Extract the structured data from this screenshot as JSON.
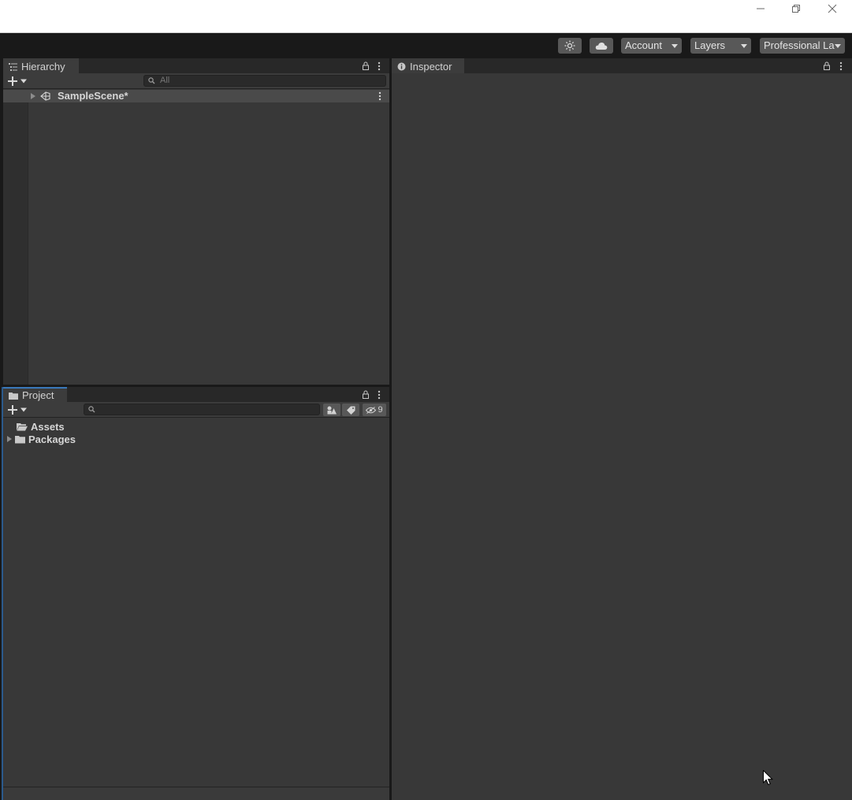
{
  "toolbar": {
    "account_label": "Account",
    "layers_label": "Layers",
    "layout_label": "Professional La",
    "icons": [
      "lighting-icon",
      "cloud-icon"
    ]
  },
  "window_controls": [
    "minimize-icon",
    "restore-icon",
    "close-icon"
  ],
  "hierarchy": {
    "tab_label": "Hierarchy",
    "search_placeholder": "All",
    "scene_name": "SampleScene*"
  },
  "project": {
    "tab_label": "Project",
    "search_placeholder": "",
    "hidden_count": "9",
    "tree": [
      {
        "label": "Assets",
        "icon": "folder-open-icon",
        "expanded": true
      },
      {
        "label": "Packages",
        "icon": "folder-icon",
        "expanded": false
      }
    ]
  },
  "inspector": {
    "tab_label": "Inspector"
  },
  "colors": {
    "background": "#191919",
    "panel": "#383838",
    "tab_active_accent": "#3a79bb",
    "button": "#585858"
  }
}
